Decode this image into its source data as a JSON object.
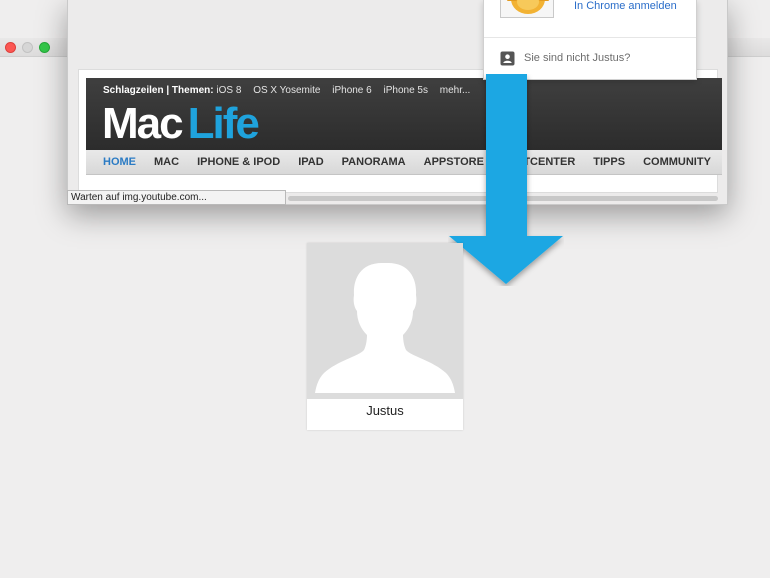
{
  "browser": {
    "status_text": "Warten auf img.youtube.com..."
  },
  "maclife": {
    "headlines_label": "Schlagzeilen | Themen:",
    "topics": [
      "iOS 8",
      "OS X Yosemite",
      "iPhone 6",
      "iPhone 5s",
      "mehr..."
    ],
    "logo_mac": "Mac",
    "logo_life": "Life",
    "nav": [
      "HOME",
      "MAC",
      "IPHONE & IPOD",
      "IPAD",
      "PANORAMA",
      "APPSTORE",
      "TESTCENTER",
      "TIPPS",
      "COMMUNITY"
    ]
  },
  "profile_menu": {
    "signin_link": "In Chrome anmelden",
    "not_you": "Sie sind nicht Justus?"
  },
  "user_card": {
    "name": "Justus"
  },
  "colors": {
    "brand_blue": "#1fa3dd",
    "arrow_blue": "#1aa7e3",
    "link_blue": "#2a6dc9"
  }
}
